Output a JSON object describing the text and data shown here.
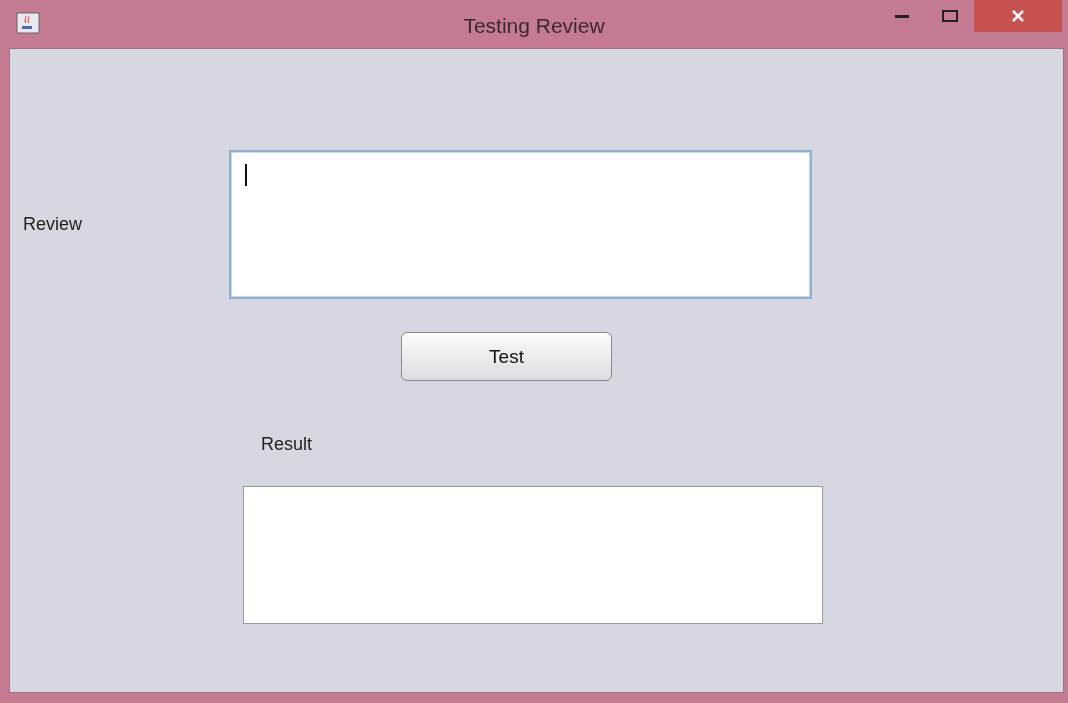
{
  "window": {
    "title": "Testing Review"
  },
  "review": {
    "label": "Review",
    "focused": true
  },
  "test_button": {
    "label": "Test"
  },
  "result": {
    "label": "Result",
    "focused": false
  }
}
